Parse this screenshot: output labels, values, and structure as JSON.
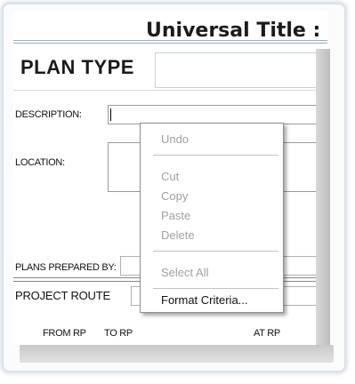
{
  "document": {
    "title": "Universal Title :",
    "plan_type_heading": "PLAN TYPE",
    "fields": {
      "description_label": "DESCRIPTION:",
      "location_label": "LOCATION:",
      "plans_prepared_by_label": "PLANS PREPARED BY:",
      "project_route_label": "PROJECT ROUTE",
      "from_rp_label": "FROM RP",
      "to_rp_label": "TO RP",
      "at_rp_label": "AT RP"
    }
  },
  "context_menu": {
    "items": [
      {
        "label": "Undo",
        "enabled": false
      },
      {
        "label": "Cut",
        "enabled": false
      },
      {
        "label": "Copy",
        "enabled": false
      },
      {
        "label": "Paste",
        "enabled": false
      },
      {
        "label": "Delete",
        "enabled": false
      },
      {
        "label": "Select All",
        "enabled": false
      },
      {
        "label": "Format Criteria...",
        "enabled": true
      }
    ]
  }
}
